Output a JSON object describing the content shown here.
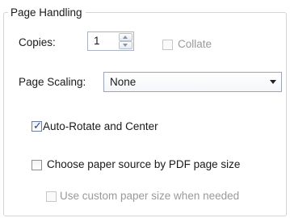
{
  "group": {
    "title": "Page Handling"
  },
  "copies": {
    "label": "Copies:",
    "value": "1"
  },
  "collate": {
    "label": "Collate",
    "checked": false,
    "enabled": false
  },
  "scaling": {
    "label": "Page Scaling:",
    "value": "None"
  },
  "auto_rotate": {
    "label": "Auto-Rotate and Center",
    "checked": true
  },
  "paper_source": {
    "label": "Choose paper source by PDF page size",
    "checked": false
  },
  "custom_paper": {
    "label": "Use custom paper size when needed",
    "checked": false,
    "enabled": false
  },
  "icons": {
    "up": "spin-up-icon",
    "down": "spin-down-icon",
    "dropdown": "chevron-down-icon",
    "check": "checkmark-icon"
  },
  "colors": {
    "border": "#d5d5d5",
    "check": "#2b3f7a",
    "disabled_text": "#9a9a9a"
  }
}
